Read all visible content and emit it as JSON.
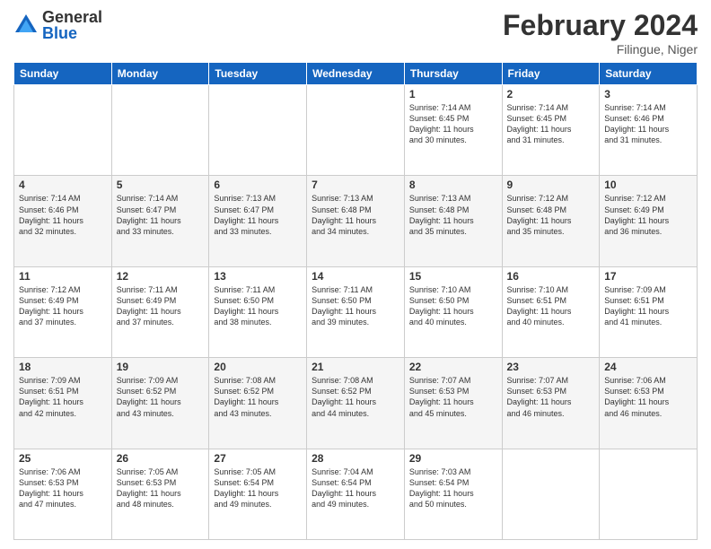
{
  "header": {
    "logo": {
      "general": "General",
      "blue": "Blue"
    },
    "title": "February 2024",
    "subtitle": "Filingue, Niger"
  },
  "weekdays": [
    "Sunday",
    "Monday",
    "Tuesday",
    "Wednesday",
    "Thursday",
    "Friday",
    "Saturday"
  ],
  "weeks": [
    [
      {
        "day": "",
        "info": ""
      },
      {
        "day": "",
        "info": ""
      },
      {
        "day": "",
        "info": ""
      },
      {
        "day": "",
        "info": ""
      },
      {
        "day": "1",
        "info": "Sunrise: 7:14 AM\nSunset: 6:45 PM\nDaylight: 11 hours\nand 30 minutes."
      },
      {
        "day": "2",
        "info": "Sunrise: 7:14 AM\nSunset: 6:45 PM\nDaylight: 11 hours\nand 31 minutes."
      },
      {
        "day": "3",
        "info": "Sunrise: 7:14 AM\nSunset: 6:46 PM\nDaylight: 11 hours\nand 31 minutes."
      }
    ],
    [
      {
        "day": "4",
        "info": "Sunrise: 7:14 AM\nSunset: 6:46 PM\nDaylight: 11 hours\nand 32 minutes."
      },
      {
        "day": "5",
        "info": "Sunrise: 7:14 AM\nSunset: 6:47 PM\nDaylight: 11 hours\nand 33 minutes."
      },
      {
        "day": "6",
        "info": "Sunrise: 7:13 AM\nSunset: 6:47 PM\nDaylight: 11 hours\nand 33 minutes."
      },
      {
        "day": "7",
        "info": "Sunrise: 7:13 AM\nSunset: 6:48 PM\nDaylight: 11 hours\nand 34 minutes."
      },
      {
        "day": "8",
        "info": "Sunrise: 7:13 AM\nSunset: 6:48 PM\nDaylight: 11 hours\nand 35 minutes."
      },
      {
        "day": "9",
        "info": "Sunrise: 7:12 AM\nSunset: 6:48 PM\nDaylight: 11 hours\nand 35 minutes."
      },
      {
        "day": "10",
        "info": "Sunrise: 7:12 AM\nSunset: 6:49 PM\nDaylight: 11 hours\nand 36 minutes."
      }
    ],
    [
      {
        "day": "11",
        "info": "Sunrise: 7:12 AM\nSunset: 6:49 PM\nDaylight: 11 hours\nand 37 minutes."
      },
      {
        "day": "12",
        "info": "Sunrise: 7:11 AM\nSunset: 6:49 PM\nDaylight: 11 hours\nand 37 minutes."
      },
      {
        "day": "13",
        "info": "Sunrise: 7:11 AM\nSunset: 6:50 PM\nDaylight: 11 hours\nand 38 minutes."
      },
      {
        "day": "14",
        "info": "Sunrise: 7:11 AM\nSunset: 6:50 PM\nDaylight: 11 hours\nand 39 minutes."
      },
      {
        "day": "15",
        "info": "Sunrise: 7:10 AM\nSunset: 6:50 PM\nDaylight: 11 hours\nand 40 minutes."
      },
      {
        "day": "16",
        "info": "Sunrise: 7:10 AM\nSunset: 6:51 PM\nDaylight: 11 hours\nand 40 minutes."
      },
      {
        "day": "17",
        "info": "Sunrise: 7:09 AM\nSunset: 6:51 PM\nDaylight: 11 hours\nand 41 minutes."
      }
    ],
    [
      {
        "day": "18",
        "info": "Sunrise: 7:09 AM\nSunset: 6:51 PM\nDaylight: 11 hours\nand 42 minutes."
      },
      {
        "day": "19",
        "info": "Sunrise: 7:09 AM\nSunset: 6:52 PM\nDaylight: 11 hours\nand 43 minutes."
      },
      {
        "day": "20",
        "info": "Sunrise: 7:08 AM\nSunset: 6:52 PM\nDaylight: 11 hours\nand 43 minutes."
      },
      {
        "day": "21",
        "info": "Sunrise: 7:08 AM\nSunset: 6:52 PM\nDaylight: 11 hours\nand 44 minutes."
      },
      {
        "day": "22",
        "info": "Sunrise: 7:07 AM\nSunset: 6:53 PM\nDaylight: 11 hours\nand 45 minutes."
      },
      {
        "day": "23",
        "info": "Sunrise: 7:07 AM\nSunset: 6:53 PM\nDaylight: 11 hours\nand 46 minutes."
      },
      {
        "day": "24",
        "info": "Sunrise: 7:06 AM\nSunset: 6:53 PM\nDaylight: 11 hours\nand 46 minutes."
      }
    ],
    [
      {
        "day": "25",
        "info": "Sunrise: 7:06 AM\nSunset: 6:53 PM\nDaylight: 11 hours\nand 47 minutes."
      },
      {
        "day": "26",
        "info": "Sunrise: 7:05 AM\nSunset: 6:53 PM\nDaylight: 11 hours\nand 48 minutes."
      },
      {
        "day": "27",
        "info": "Sunrise: 7:05 AM\nSunset: 6:54 PM\nDaylight: 11 hours\nand 49 minutes."
      },
      {
        "day": "28",
        "info": "Sunrise: 7:04 AM\nSunset: 6:54 PM\nDaylight: 11 hours\nand 49 minutes."
      },
      {
        "day": "29",
        "info": "Sunrise: 7:03 AM\nSunset: 6:54 PM\nDaylight: 11 hours\nand 50 minutes."
      },
      {
        "day": "",
        "info": ""
      },
      {
        "day": "",
        "info": ""
      }
    ]
  ]
}
